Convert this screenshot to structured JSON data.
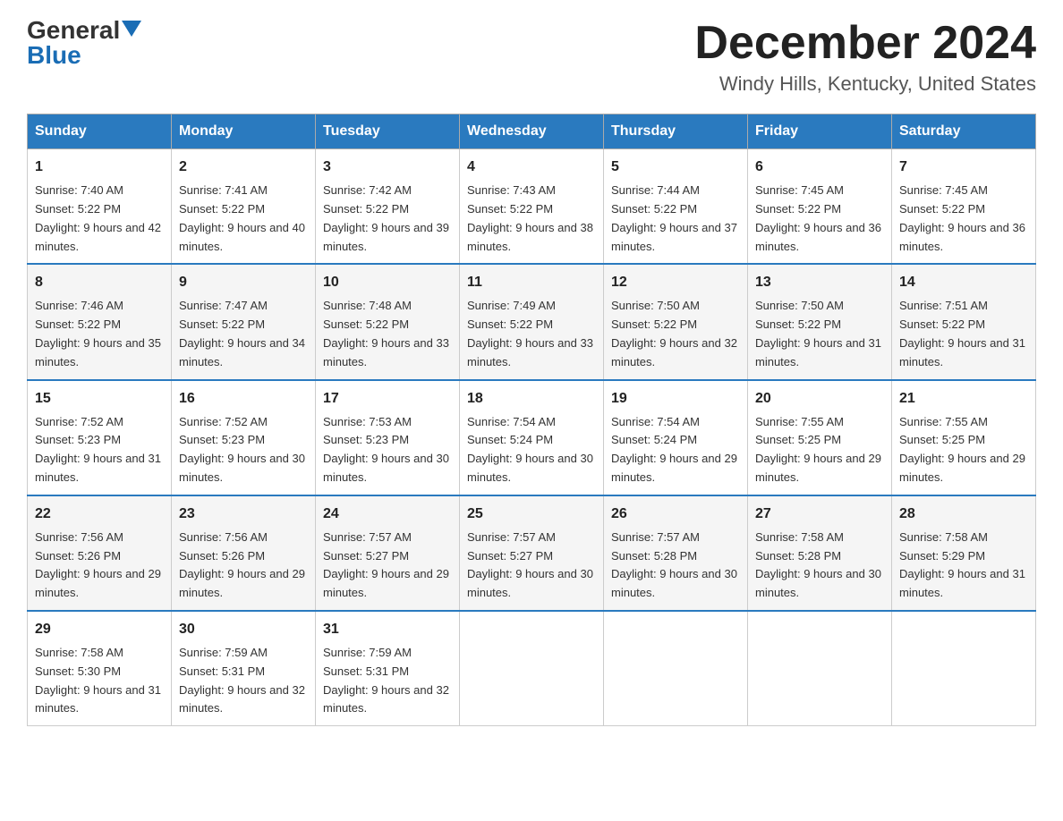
{
  "header": {
    "logo_general": "General",
    "logo_blue": "Blue",
    "month": "December 2024",
    "location": "Windy Hills, Kentucky, United States"
  },
  "days_of_week": [
    "Sunday",
    "Monday",
    "Tuesday",
    "Wednesday",
    "Thursday",
    "Friday",
    "Saturday"
  ],
  "weeks": [
    [
      {
        "day": "1",
        "sunrise": "7:40 AM",
        "sunset": "5:22 PM",
        "daylight": "9 hours and 42 minutes."
      },
      {
        "day": "2",
        "sunrise": "7:41 AM",
        "sunset": "5:22 PM",
        "daylight": "9 hours and 40 minutes."
      },
      {
        "day": "3",
        "sunrise": "7:42 AM",
        "sunset": "5:22 PM",
        "daylight": "9 hours and 39 minutes."
      },
      {
        "day": "4",
        "sunrise": "7:43 AM",
        "sunset": "5:22 PM",
        "daylight": "9 hours and 38 minutes."
      },
      {
        "day": "5",
        "sunrise": "7:44 AM",
        "sunset": "5:22 PM",
        "daylight": "9 hours and 37 minutes."
      },
      {
        "day": "6",
        "sunrise": "7:45 AM",
        "sunset": "5:22 PM",
        "daylight": "9 hours and 36 minutes."
      },
      {
        "day": "7",
        "sunrise": "7:45 AM",
        "sunset": "5:22 PM",
        "daylight": "9 hours and 36 minutes."
      }
    ],
    [
      {
        "day": "8",
        "sunrise": "7:46 AM",
        "sunset": "5:22 PM",
        "daylight": "9 hours and 35 minutes."
      },
      {
        "day": "9",
        "sunrise": "7:47 AM",
        "sunset": "5:22 PM",
        "daylight": "9 hours and 34 minutes."
      },
      {
        "day": "10",
        "sunrise": "7:48 AM",
        "sunset": "5:22 PM",
        "daylight": "9 hours and 33 minutes."
      },
      {
        "day": "11",
        "sunrise": "7:49 AM",
        "sunset": "5:22 PM",
        "daylight": "9 hours and 33 minutes."
      },
      {
        "day": "12",
        "sunrise": "7:50 AM",
        "sunset": "5:22 PM",
        "daylight": "9 hours and 32 minutes."
      },
      {
        "day": "13",
        "sunrise": "7:50 AM",
        "sunset": "5:22 PM",
        "daylight": "9 hours and 31 minutes."
      },
      {
        "day": "14",
        "sunrise": "7:51 AM",
        "sunset": "5:22 PM",
        "daylight": "9 hours and 31 minutes."
      }
    ],
    [
      {
        "day": "15",
        "sunrise": "7:52 AM",
        "sunset": "5:23 PM",
        "daylight": "9 hours and 31 minutes."
      },
      {
        "day": "16",
        "sunrise": "7:52 AM",
        "sunset": "5:23 PM",
        "daylight": "9 hours and 30 minutes."
      },
      {
        "day": "17",
        "sunrise": "7:53 AM",
        "sunset": "5:23 PM",
        "daylight": "9 hours and 30 minutes."
      },
      {
        "day": "18",
        "sunrise": "7:54 AM",
        "sunset": "5:24 PM",
        "daylight": "9 hours and 30 minutes."
      },
      {
        "day": "19",
        "sunrise": "7:54 AM",
        "sunset": "5:24 PM",
        "daylight": "9 hours and 29 minutes."
      },
      {
        "day": "20",
        "sunrise": "7:55 AM",
        "sunset": "5:25 PM",
        "daylight": "9 hours and 29 minutes."
      },
      {
        "day": "21",
        "sunrise": "7:55 AM",
        "sunset": "5:25 PM",
        "daylight": "9 hours and 29 minutes."
      }
    ],
    [
      {
        "day": "22",
        "sunrise": "7:56 AM",
        "sunset": "5:26 PM",
        "daylight": "9 hours and 29 minutes."
      },
      {
        "day": "23",
        "sunrise": "7:56 AM",
        "sunset": "5:26 PM",
        "daylight": "9 hours and 29 minutes."
      },
      {
        "day": "24",
        "sunrise": "7:57 AM",
        "sunset": "5:27 PM",
        "daylight": "9 hours and 29 minutes."
      },
      {
        "day": "25",
        "sunrise": "7:57 AM",
        "sunset": "5:27 PM",
        "daylight": "9 hours and 30 minutes."
      },
      {
        "day": "26",
        "sunrise": "7:57 AM",
        "sunset": "5:28 PM",
        "daylight": "9 hours and 30 minutes."
      },
      {
        "day": "27",
        "sunrise": "7:58 AM",
        "sunset": "5:28 PM",
        "daylight": "9 hours and 30 minutes."
      },
      {
        "day": "28",
        "sunrise": "7:58 AM",
        "sunset": "5:29 PM",
        "daylight": "9 hours and 31 minutes."
      }
    ],
    [
      {
        "day": "29",
        "sunrise": "7:58 AM",
        "sunset": "5:30 PM",
        "daylight": "9 hours and 31 minutes."
      },
      {
        "day": "30",
        "sunrise": "7:59 AM",
        "sunset": "5:31 PM",
        "daylight": "9 hours and 32 minutes."
      },
      {
        "day": "31",
        "sunrise": "7:59 AM",
        "sunset": "5:31 PM",
        "daylight": "9 hours and 32 minutes."
      },
      null,
      null,
      null,
      null
    ]
  ]
}
